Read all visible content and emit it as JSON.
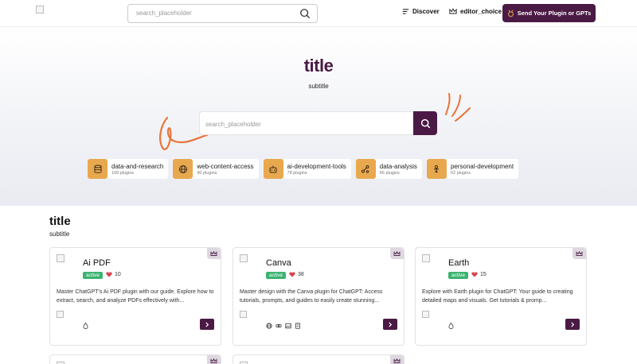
{
  "header": {
    "search_placeholder": "search_placeholder",
    "nav_discover": "Discover",
    "nav_editor_choice": "editor_choice",
    "send_button_label": "Send Your Plugin or GPTs"
  },
  "hero": {
    "title": "title",
    "subtitle": "subtitle",
    "search_placeholder": "search_placeholder"
  },
  "categories": [
    {
      "name": "data-and-research",
      "count": "109 plugins",
      "icon": "database-icon"
    },
    {
      "name": "web-content-access",
      "count": "90 plugins",
      "icon": "globe-icon"
    },
    {
      "name": "ai-development-tools",
      "count": "78 plugins",
      "icon": "robot-icon"
    },
    {
      "name": "data-analysis",
      "count": "66 plugins",
      "icon": "analytics-icon"
    },
    {
      "name": "personal-development",
      "count": "62 plugins",
      "icon": "person-growth-icon"
    }
  ],
  "section": {
    "title": "title",
    "subtitle": "subtitle"
  },
  "cards": [
    {
      "name": "Ai PDF",
      "status": "active",
      "likes": "10",
      "description": "Master ChatGPT's Ai PDF plugin with our guide. Explore how to extract, search, and analyze PDFs effectively with...",
      "tools": [
        "drop-icon"
      ]
    },
    {
      "name": "Canva",
      "status": "active",
      "likes": "38",
      "description": "Master design with the Canva plugin for ChatGPT: Access tutorials, prompts, and guides to easily create stunning...",
      "tools": [
        "globe-icon",
        "link-icon",
        "image-icon",
        "document-icon"
      ]
    },
    {
      "name": "Earth",
      "status": "active",
      "likes": "15",
      "description": "Explore with Earth plugin for ChatGPT: Your guide to creating detailed maps and visuals. Get tutorials & promp...",
      "tools": [
        "drop-icon"
      ]
    }
  ],
  "colors": {
    "brand": "#4a1a44",
    "category_icon_bg": "#e8a84e",
    "status_active": "#3cb371",
    "heart": "#d64550",
    "squiggle": "#e8743a"
  }
}
